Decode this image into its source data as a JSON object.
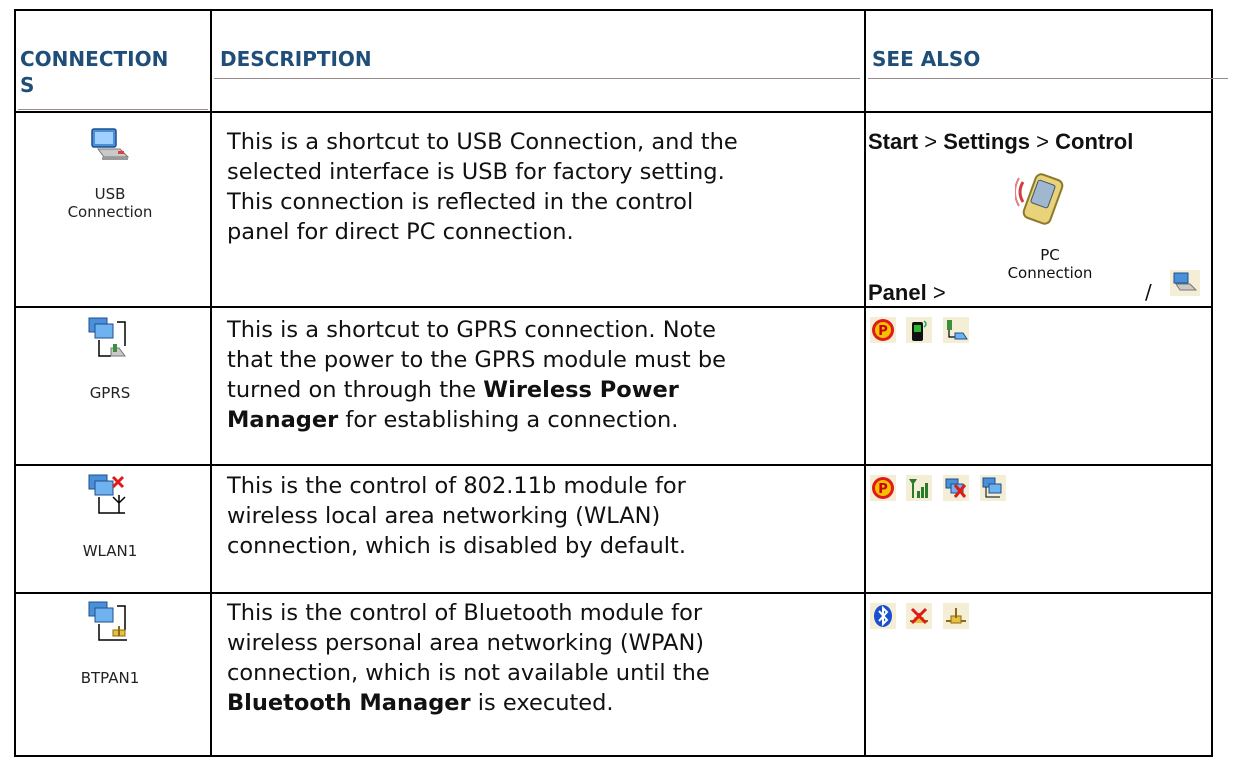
{
  "headers": {
    "connections": "CONNECTION",
    "connections_cont": "S",
    "description": "DESCRIPTION",
    "see_also": "SEE ALSO"
  },
  "rows": [
    {
      "icon_name": "usb-connection-icon",
      "caption_line1": "USB",
      "caption_line2": "Connection",
      "desc_lines": [
        "This is a shortcut to USB Connection, and the",
        "selected interface is USB for factory setting.",
        "This connection is reflected in the control",
        "panel for direct PC connection."
      ],
      "see_also": {
        "start": "Start",
        "sep": ">",
        "settings": "Settings",
        "control": "Control",
        "panel": "Panel",
        "pc_line1": "PC",
        "pc_line2": "Connection",
        "slash": "/"
      }
    },
    {
      "icon_name": "gprs-icon",
      "caption": "GPRS",
      "desc_line1": "This is a shortcut to GPRS connection. Note",
      "desc_line2": "that the power to the GPRS module must be",
      "desc_line3a": "turned on through the ",
      "desc_line3b": "Wireless Power",
      "desc_line4a": "Manager",
      "desc_line4b": " for establishing a connection.",
      "see_icons": [
        "power-icon",
        "gprs-phone-icon",
        "gprs-connection-icon"
      ]
    },
    {
      "icon_name": "wlan-icon",
      "caption": "WLAN1",
      "desc_lines": [
        "This is the control of 802.11b module for",
        "wireless local area networking (WLAN)",
        "connection, which is disabled by default."
      ],
      "see_icons": [
        "power-icon",
        "signal-strength-icon",
        "network-disabled-icon",
        "network-icon"
      ]
    },
    {
      "icon_name": "btpan-icon",
      "caption": "BTPAN1",
      "desc_line1": "This is the control of Bluetooth module for",
      "desc_line2": "wireless personal area networking (WPAN)",
      "desc_line3": "connection, which is not available until the",
      "desc_line4a": "Bluetooth Manager",
      "desc_line4b": " is executed.",
      "see_icons": [
        "bluetooth-icon",
        "bluetooth-disabled-icon",
        "bluetooth-network-icon"
      ]
    }
  ],
  "colors": {
    "header": "#1f4e79",
    "rule": "#9a8c8c"
  }
}
